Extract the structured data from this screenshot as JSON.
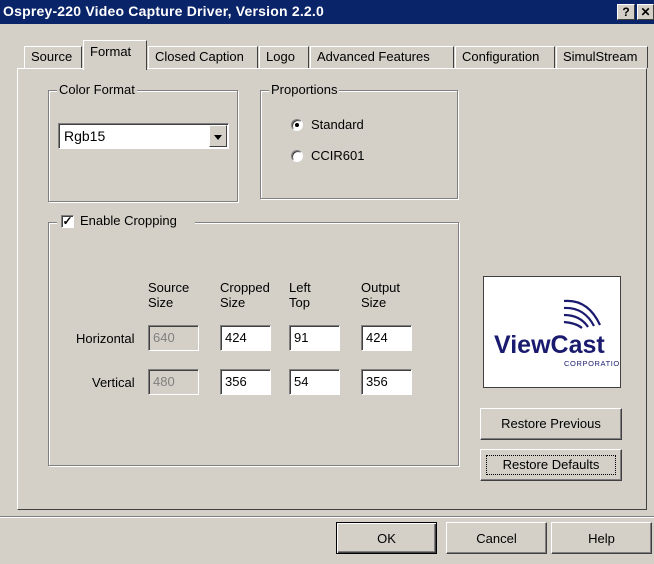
{
  "window": {
    "title": "Osprey-220 Video Capture Driver, Version 2.2.0",
    "help_glyph": "?",
    "close_glyph": "✕"
  },
  "tabs": [
    {
      "label": "Source"
    },
    {
      "label": "Format"
    },
    {
      "label": "Closed Caption"
    },
    {
      "label": "Logo"
    },
    {
      "label": "Advanced Features"
    },
    {
      "label": "Configuration"
    },
    {
      "label": "SimulStream"
    }
  ],
  "color_format": {
    "group_label": "Color Format",
    "selected": "Rgb15"
  },
  "proportions": {
    "group_label": "Proportions",
    "options": [
      {
        "label": "Standard",
        "selected": true
      },
      {
        "label": "CCIR601",
        "selected": false
      }
    ]
  },
  "cropping": {
    "enable_label": "Enable Cropping",
    "enabled": true,
    "headers": {
      "source": [
        "Source",
        "Size"
      ],
      "cropped": [
        "Cropped",
        "Size"
      ],
      "lefttop": [
        "Left",
        "Top"
      ],
      "output": [
        "Output",
        "Size"
      ]
    },
    "rows": [
      {
        "label": "Horizontal",
        "source": "640",
        "cropped": "424",
        "lefttop": "91",
        "output": "424"
      },
      {
        "label": "Vertical",
        "source": "480",
        "cropped": "356",
        "lefttop": "54",
        "output": "356"
      }
    ]
  },
  "logo": {
    "brand": "ViewCast",
    "sub": "CORPORATION",
    "brand_color": "#1a1a6e"
  },
  "buttons": {
    "restore_previous": "Restore Previous",
    "restore_defaults": "Restore Defaults",
    "ok": "OK",
    "cancel": "Cancel",
    "help": "Help"
  }
}
